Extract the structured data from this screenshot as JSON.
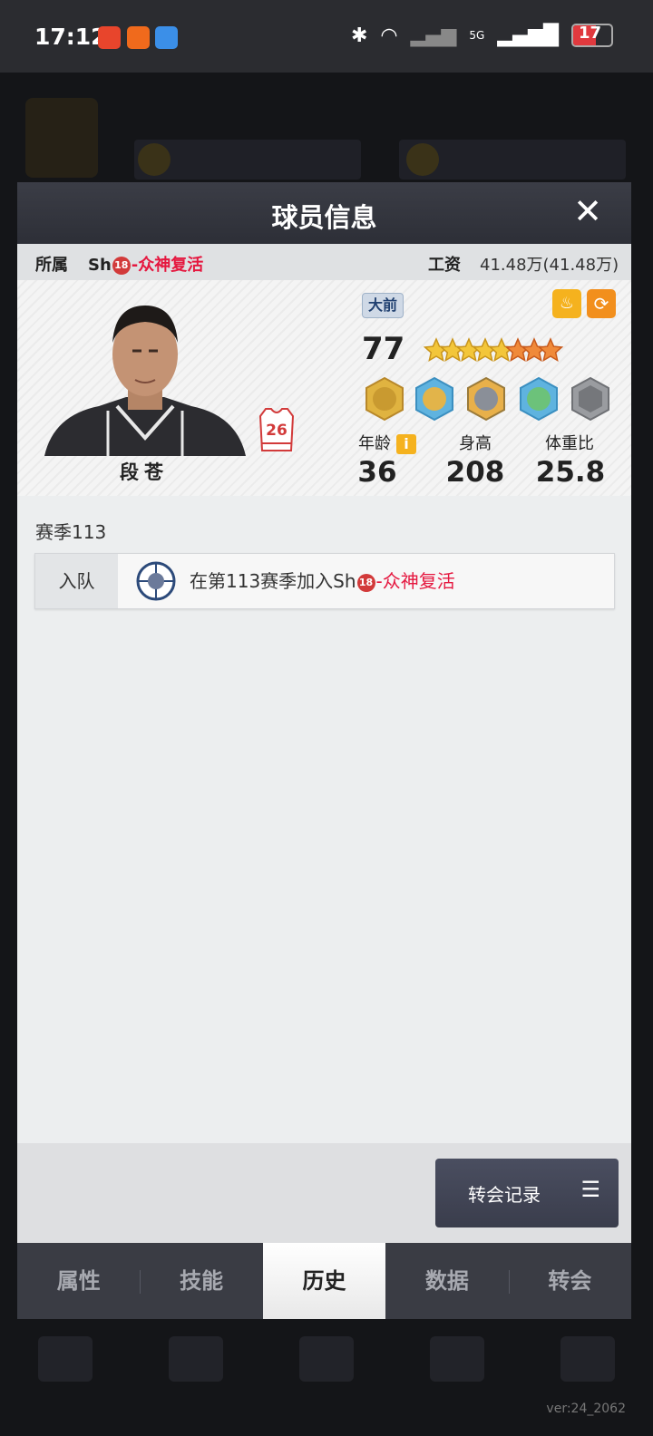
{
  "status": {
    "time": "17:12",
    "network": "5G",
    "battery": "17"
  },
  "modal": {
    "title": "球员信息",
    "close_icon": "close-icon",
    "affiliation_label": "所属",
    "team_prefix": "Sh",
    "team_badge": "18",
    "team_name": "-众神复活",
    "salary_label": "工资",
    "salary_value": "41.48万(41.48万)",
    "player": {
      "name": "段苍",
      "jersey_number": "26",
      "position": "大前",
      "rating": "77",
      "stars_total": 8,
      "stars_gold": 5,
      "age_label": "年龄",
      "age": "36",
      "height_label": "身高",
      "height": "208",
      "weight_label": "体重比",
      "weight_ratio": "25.8"
    },
    "season_label": "赛季113",
    "history": [
      {
        "type": "入队",
        "text_prefix": "在第113赛季加入Sh",
        "badge": "18",
        "team": "-众神复活"
      }
    ],
    "transfer_record_label": "转会记录",
    "tabs": [
      "属性",
      "技能",
      "历史",
      "数据",
      "转会"
    ],
    "active_tab": "历史"
  },
  "footer": {
    "version": "ver:24_2062"
  },
  "colors": {
    "accent_red": "#e5173f",
    "header_dark": "#2d2f37",
    "gold": "#f5b21e"
  }
}
